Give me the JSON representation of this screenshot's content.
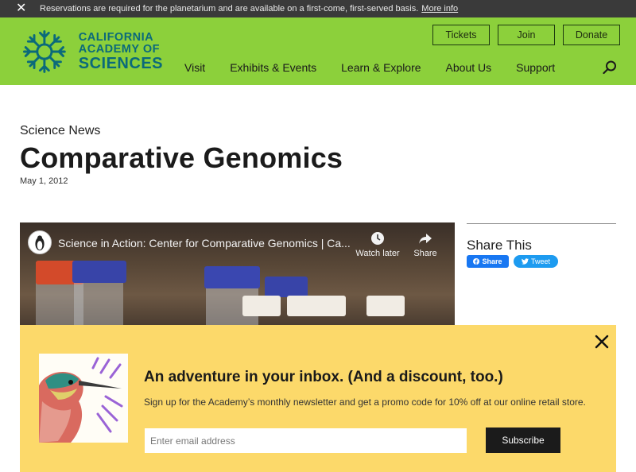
{
  "alert": {
    "message": "Reservations are required for the planetarium and are available on a first-come, first-served basis.",
    "link": "More info"
  },
  "logo": {
    "line1": "CALIFORNIA",
    "line2": "ACADEMY OF",
    "line3": "SCIENCES"
  },
  "utility_nav": [
    "Tickets",
    "Join",
    "Donate"
  ],
  "main_nav": [
    "Visit",
    "Exhibits & Events",
    "Learn & Explore",
    "About Us",
    "Support"
  ],
  "article": {
    "kicker": "Science News",
    "title": "Comparative Genomics",
    "date": "May 1, 2012"
  },
  "video": {
    "title": "Science in Action: Center for Comparative Genomics | Ca...",
    "watch_later": "Watch later",
    "share": "Share"
  },
  "share": {
    "title": "Share This",
    "facebook": "Share",
    "twitter": "Tweet"
  },
  "newsletter": {
    "heading": "An adventure in your inbox. (And a discount, too.)",
    "subtext": "Sign up for the Academy’s monthly newsletter and get a promo code for 10% off at our online retail store.",
    "email_placeholder": "Enter email address",
    "button": "Subscribe"
  },
  "colors": {
    "brand_green": "#8cd03b",
    "brand_teal": "#0b6a7a",
    "alert_bg": "#3a3a3a",
    "newsletter_bg": "#fcd96a"
  }
}
